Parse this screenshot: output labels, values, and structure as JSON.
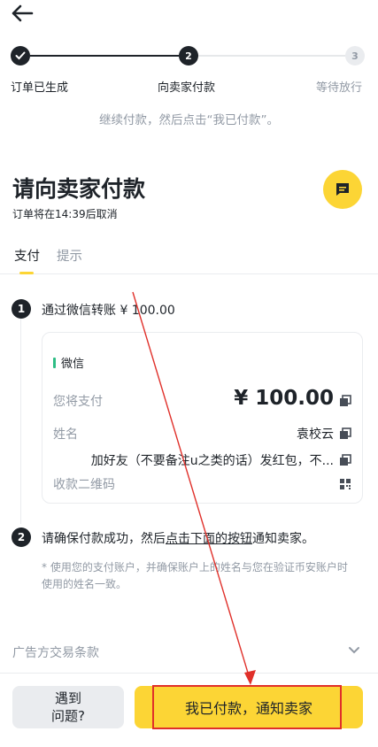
{
  "stepper": {
    "steps": [
      {
        "num": "",
        "label": "订单已生成"
      },
      {
        "num": "2",
        "label": "向卖家付款"
      },
      {
        "num": "3",
        "label": "等待放行"
      }
    ]
  },
  "hint": "继续付款，然后点击“我已付款”。",
  "title": "请向卖家付款",
  "subtitle": "订单将在14:39后取消",
  "tabs": [
    "支付",
    "提示"
  ],
  "step1": {
    "num": "1",
    "text": "通过微信转账 ¥ 100.00"
  },
  "card": {
    "method": "微信",
    "rows": [
      {
        "label": "您将支付",
        "value": "¥ 100.00"
      },
      {
        "label": "姓名",
        "value": "袁校云"
      },
      {
        "label": "",
        "value": "加好友（不要备注u之类的话）发红包，不..."
      },
      {
        "label": "收款二维码",
        "value": ""
      }
    ]
  },
  "step2": {
    "num": "2",
    "text_pre": "请确保付款成功，然后",
    "text_link": "点击下面的按钮",
    "text_post": "通知卖家。"
  },
  "note": "* 使用您的支付账户，并确保账户上的姓名与您在验证币安账户时使用的姓名一致。",
  "ad_terms": "广告方交易条款",
  "buttons": {
    "problem": "遇到\n问题?",
    "paid": "我已付款，通知卖家"
  },
  "colors": {
    "accent": "#fcd535",
    "text": "#1e2329",
    "muted": "#929aa5",
    "wechat": "#2ebd85",
    "annotation": "#e0302a"
  }
}
